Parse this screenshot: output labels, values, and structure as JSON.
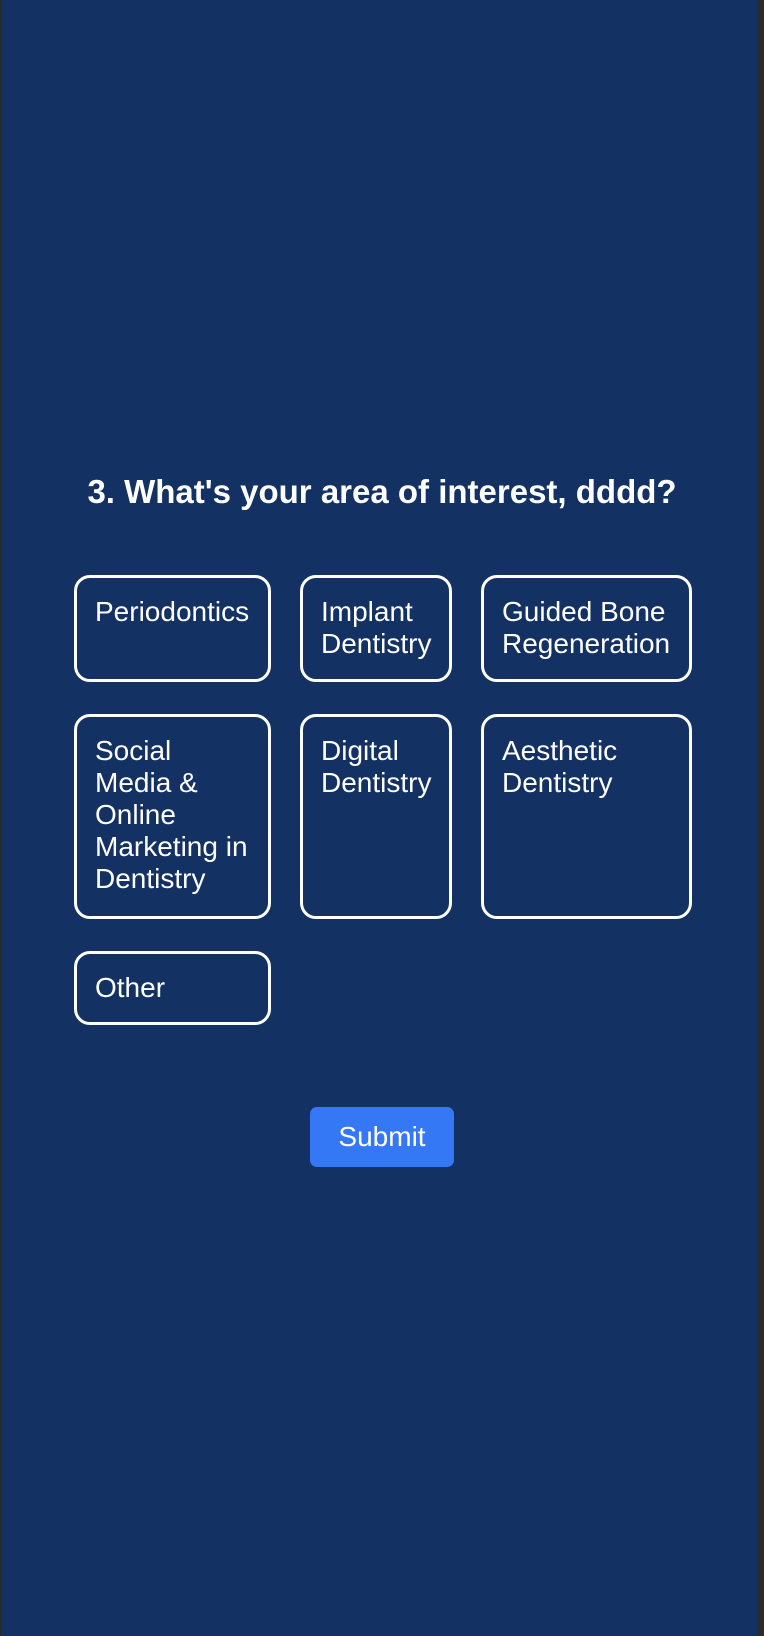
{
  "question": {
    "text": "3. What's your area of interest, dddd?"
  },
  "options": [
    {
      "label": "Periodontics"
    },
    {
      "label": "Implant Dentistry"
    },
    {
      "label": "Guided Bone Regeneration"
    },
    {
      "label": "Social Media & Online Marketing in Dentistry"
    },
    {
      "label": "Digital Dentistry"
    },
    {
      "label": "Aesthetic Dentistry"
    },
    {
      "label": "Other"
    }
  ],
  "submit": {
    "label": "Submit"
  },
  "colors": {
    "background": "#133162",
    "option_border": "#ffffff",
    "submit_button": "#3478f6",
    "text": "#ffffff"
  }
}
